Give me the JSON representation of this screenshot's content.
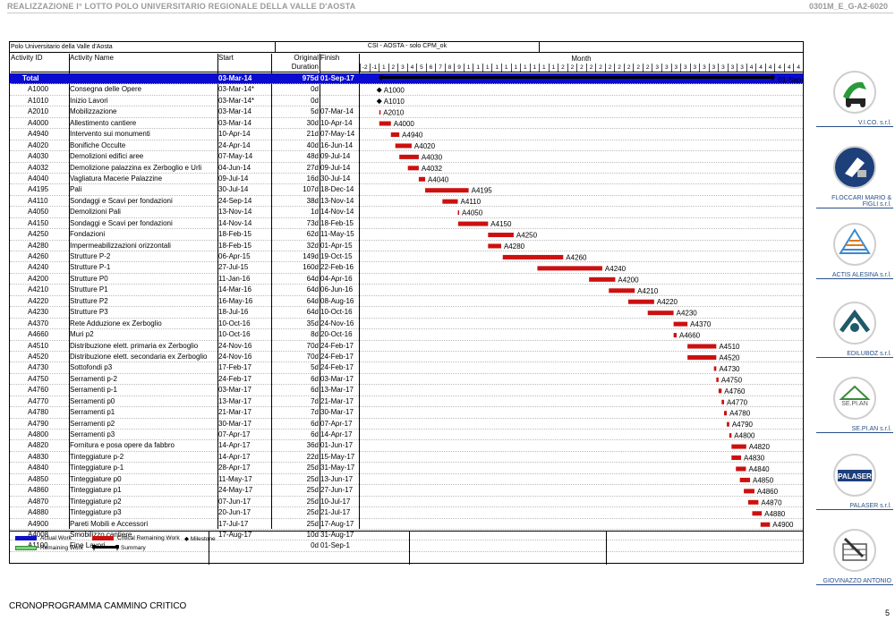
{
  "header": {
    "title": "REALIZZAZIONE I° LOTTO POLO UNIVERSITARIO REGIONALE DELLA VALLE D'AOSTA",
    "code": "0301M_E_G-A2-6020"
  },
  "project": {
    "name": "Polo Universitario della Valle d'Aosta",
    "layout": "CSI - AOSTA - solo CPM_ok"
  },
  "columns": {
    "id": "Activity ID",
    "name": "Activity Name",
    "start": "Start",
    "duration": "Original Duration",
    "finish": "Finish",
    "timeline": "Month"
  },
  "month_ticks": [
    "-2",
    "-1",
    "1",
    "2",
    "3",
    "4",
    "5",
    "6",
    "7",
    "8",
    "9",
    "1",
    "1",
    "1",
    "1",
    "1",
    "1",
    "1",
    "1",
    "1",
    "1",
    "2",
    "2",
    "2",
    "2",
    "2",
    "2",
    "2",
    "2",
    "2",
    "2",
    "3",
    "3",
    "3",
    "3",
    "3",
    "3",
    "3",
    "3",
    "3",
    "3",
    "4",
    "4",
    "4",
    "4",
    "4",
    "4"
  ],
  "total": {
    "id": "Total",
    "start": "03-Mar-14",
    "duration": "975d",
    "finish": "01-Sep-17",
    "label": "01-Sep-17,"
  },
  "activities": [
    {
      "id": "A1000",
      "name": "Consegna delle Opere",
      "start": "03-Mar-14*",
      "duration": "0d",
      "finish": "",
      "type": "milestone"
    },
    {
      "id": "A1010",
      "name": "Inizio Lavori",
      "start": "03-Mar-14*",
      "duration": "0d",
      "finish": "",
      "type": "milestone"
    },
    {
      "id": "A2010",
      "name": "Mobilizzazione",
      "start": "03-Mar-14",
      "duration": "5d",
      "finish": "07-Mar-14",
      "type": "task"
    },
    {
      "id": "A4000",
      "name": "Allestimento cantiere",
      "start": "03-Mar-14",
      "duration": "30d",
      "finish": "10-Apr-14",
      "type": "task"
    },
    {
      "id": "A4940",
      "name": "Intervento sui monumenti",
      "start": "10-Apr-14",
      "duration": "21d",
      "finish": "07-May-14",
      "type": "task"
    },
    {
      "id": "A4020",
      "name": "Bonifiche Occulte",
      "start": "24-Apr-14",
      "duration": "40d",
      "finish": "16-Jun-14",
      "type": "task"
    },
    {
      "id": "A4030",
      "name": "Demolizioni edifici aree",
      "start": "07-May-14",
      "duration": "48d",
      "finish": "09-Jul-14",
      "type": "task"
    },
    {
      "id": "A4032",
      "name": "Demolizione palazzina ex Zerboglio e Urli",
      "start": "04-Jun-14",
      "duration": "27d",
      "finish": "09-Jul-14",
      "type": "task"
    },
    {
      "id": "A4040",
      "name": "Vagliatura Macerie Palazzine",
      "start": "09-Jul-14",
      "duration": "16d",
      "finish": "30-Jul-14",
      "type": "task"
    },
    {
      "id": "A4195",
      "name": "Pali",
      "start": "30-Jul-14",
      "duration": "107d",
      "finish": "18-Dec-14",
      "type": "task"
    },
    {
      "id": "A4110",
      "name": "Sondaggi e Scavi per fondazioni",
      "start": "24-Sep-14",
      "duration": "38d",
      "finish": "13-Nov-14",
      "type": "task"
    },
    {
      "id": "A4050",
      "name": "Demolizioni Pali",
      "start": "13-Nov-14",
      "duration": "1d",
      "finish": "14-Nov-14",
      "type": "task"
    },
    {
      "id": "A4150",
      "name": "Sondaggi e Scavi per fondazioni",
      "start": "14-Nov-14",
      "duration": "73d",
      "finish": "18-Feb-15",
      "type": "task"
    },
    {
      "id": "A4250",
      "name": "Fondazioni",
      "start": "18-Feb-15",
      "duration": "62d",
      "finish": "11-May-15",
      "type": "task"
    },
    {
      "id": "A4280",
      "name": "Impermeabilizzazioni orizzontali",
      "start": "18-Feb-15",
      "duration": "32d",
      "finish": "01-Apr-15",
      "type": "task"
    },
    {
      "id": "A4260",
      "name": "Strutture P-2",
      "start": "06-Apr-15",
      "duration": "149d",
      "finish": "19-Oct-15",
      "type": "task"
    },
    {
      "id": "A4240",
      "name": "Strutture P-1",
      "start": "27-Jul-15",
      "duration": "160d",
      "finish": "22-Feb-16",
      "type": "task"
    },
    {
      "id": "A4200",
      "name": "Strutture P0",
      "start": "11-Jan-16",
      "duration": "64d",
      "finish": "04-Apr-16",
      "type": "task"
    },
    {
      "id": "A4210",
      "name": "Strutture P1",
      "start": "14-Mar-16",
      "duration": "64d",
      "finish": "06-Jun-16",
      "type": "task"
    },
    {
      "id": "A4220",
      "name": "Strutture P2",
      "start": "16-May-16",
      "duration": "64d",
      "finish": "08-Aug-16",
      "type": "task"
    },
    {
      "id": "A4230",
      "name": "Strutture P3",
      "start": "18-Jul-16",
      "duration": "64d",
      "finish": "10-Oct-16",
      "type": "task"
    },
    {
      "id": "A4370",
      "name": "Rete Adduzione ex Zerboglio",
      "start": "10-Oct-16",
      "duration": "35d",
      "finish": "24-Nov-16",
      "type": "task"
    },
    {
      "id": "A4660",
      "name": "Muri p2",
      "start": "10-Oct-16",
      "duration": "8d",
      "finish": "20-Oct-16",
      "type": "task"
    },
    {
      "id": "A4510",
      "name": "Distribuzione elett. primaria ex Zerboglio",
      "start": "24-Nov-16",
      "duration": "70d",
      "finish": "24-Feb-17",
      "type": "task"
    },
    {
      "id": "A4520",
      "name": "Distribuzione elett. secondaria ex Zerboglio",
      "start": "24-Nov-16",
      "duration": "70d",
      "finish": "24-Feb-17",
      "type": "task"
    },
    {
      "id": "A4730",
      "name": "Sottofondi p3",
      "start": "17-Feb-17",
      "duration": "5d",
      "finish": "24-Feb-17",
      "type": "task"
    },
    {
      "id": "A4750",
      "name": "Serramenti p-2",
      "start": "24-Feb-17",
      "duration": "6d",
      "finish": "03-Mar-17",
      "type": "task"
    },
    {
      "id": "A4760",
      "name": "Serramenti p-1",
      "start": "03-Mar-17",
      "duration": "6d",
      "finish": "13-Mar-17",
      "type": "task"
    },
    {
      "id": "A4770",
      "name": "Serramenti p0",
      "start": "13-Mar-17",
      "duration": "7d",
      "finish": "21-Mar-17",
      "type": "task"
    },
    {
      "id": "A4780",
      "name": "Serramenti p1",
      "start": "21-Mar-17",
      "duration": "7d",
      "finish": "30-Mar-17",
      "type": "task"
    },
    {
      "id": "A4790",
      "name": "Serramenti p2",
      "start": "30-Mar-17",
      "duration": "6d",
      "finish": "07-Apr-17",
      "type": "task"
    },
    {
      "id": "A4800",
      "name": "Serramenti p3",
      "start": "07-Apr-17",
      "duration": "6d",
      "finish": "14-Apr-17",
      "type": "task"
    },
    {
      "id": "A4820",
      "name": "Fornitura e posa opere da fabbro",
      "start": "14-Apr-17",
      "duration": "36d",
      "finish": "01-Jun-17",
      "type": "task"
    },
    {
      "id": "A4830",
      "name": "Tinteggiature p-2",
      "start": "14-Apr-17",
      "duration": "22d",
      "finish": "15-May-17",
      "type": "task"
    },
    {
      "id": "A4840",
      "name": "Tinteggiature p-1",
      "start": "28-Apr-17",
      "duration": "25d",
      "finish": "31-May-17",
      "type": "task"
    },
    {
      "id": "A4850",
      "name": "Tinteggiature p0",
      "start": "11-May-17",
      "duration": "25d",
      "finish": "13-Jun-17",
      "type": "task"
    },
    {
      "id": "A4860",
      "name": "Tinteggiature p1",
      "start": "24-May-17",
      "duration": "25d",
      "finish": "27-Jun-17",
      "type": "task"
    },
    {
      "id": "A4870",
      "name": "Tinteggiature p2",
      "start": "07-Jun-17",
      "duration": "25d",
      "finish": "10-Jul-17",
      "type": "task"
    },
    {
      "id": "A4880",
      "name": "Tinteggiature p3",
      "start": "20-Jun-17",
      "duration": "25d",
      "finish": "21-Jul-17",
      "type": "task"
    },
    {
      "id": "A4900",
      "name": "Pareti Mobili e Accessori",
      "start": "17-Jul-17",
      "duration": "25d",
      "finish": "17-Aug-17",
      "type": "task"
    },
    {
      "id": "A4008",
      "name": "Smobilizzo cantiere",
      "start": "17-Aug-17",
      "duration": "10d",
      "finish": "31-Aug-17",
      "type": "task"
    },
    {
      "id": "A1100",
      "name": "Fine Lavori",
      "start": "",
      "duration": "0d",
      "finish": "01-Sep-1",
      "type": "milestone"
    }
  ],
  "legend": {
    "actual": "Actual Work",
    "remaining": "Remaining Work",
    "critical": "Critical Remaining Work",
    "milestone": "Milestone",
    "summary": "Summary"
  },
  "colors": {
    "actual": "#1010c8",
    "remaining": "#7ad27a",
    "critical": "#cc1010",
    "summary_row": "#0a0ad0"
  },
  "logos": [
    {
      "name": "V.I.CO. s.r.l.",
      "icon": "vico-logo"
    },
    {
      "name": "FLOCCARI MARIO & FIGLI s.r.l.",
      "icon": "floccari-logo"
    },
    {
      "name": "ACTIS ALESINA s.r.l.",
      "icon": "actis-logo"
    },
    {
      "name": "EDILUBOZ s.r.l.",
      "icon": "ediluboz-logo"
    },
    {
      "name": "SE.PI.AN s.r.l.",
      "icon": "sepian-logo"
    },
    {
      "name": "PALASER s.r.l.",
      "icon": "palaser-logo"
    },
    {
      "name": "GIOVINAZZO ANTONIO",
      "icon": "giovinazzo-logo"
    }
  ],
  "logo_texts": {
    "palaser": "PALASER",
    "sepian": "SE.PI.AN"
  },
  "footer": {
    "title": "CRONOPROGRAMMA CAMMINO CRITICO",
    "page": "5"
  }
}
